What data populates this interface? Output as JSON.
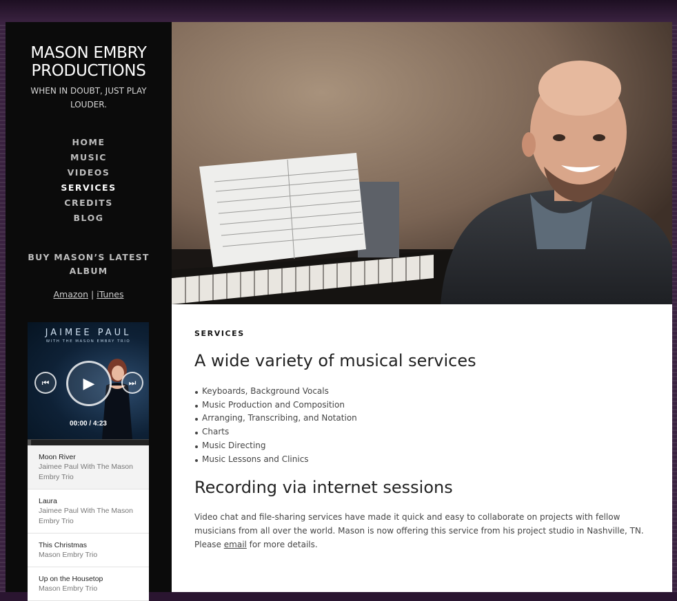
{
  "site": {
    "title_line1": "MASON EMBRY",
    "title_line2": "PRODUCTIONS",
    "tagline": "WHEN IN DOUBT, JUST PLAY LOUDER."
  },
  "nav": {
    "items": [
      "HOME",
      "MUSIC",
      "VIDEOS",
      "SERVICES",
      "CREDITS",
      "BLOG"
    ],
    "active": "SERVICES"
  },
  "buy": {
    "title": "BUY MASON’S LATEST ALBUM",
    "amazon": "Amazon",
    "separator": "|",
    "itunes": "iTunes"
  },
  "player": {
    "cover_artist": "JAIMEE PAUL",
    "cover_subtitle": "WITH THE MASON EMBRY TRIO",
    "time_current": "00:00",
    "time_separator": "/",
    "time_total": "4:23",
    "progress": 0.03,
    "icons": {
      "prev": "skip-back-icon",
      "play": "play-icon",
      "next": "skip-forward-icon"
    },
    "tracks": [
      {
        "title": "Moon River",
        "artist": "Jaimee Paul With The Mason Embry Trio"
      },
      {
        "title": "Laura",
        "artist": "Jaimee Paul With The Mason Embry Trio"
      },
      {
        "title": "This Christmas",
        "artist": "Mason Embry Trio"
      },
      {
        "title": "Up on the Housetop",
        "artist": "Mason Embry Trio"
      }
    ]
  },
  "content": {
    "label": "SERVICES",
    "heading1": "A wide variety of musical services",
    "services": [
      "Keyboards, Background Vocals",
      "Music Production and Composition",
      "Arranging, Transcribing, and Notation",
      "Charts",
      "Music Directing",
      "Music Lessons and Clinics"
    ],
    "heading2": "Recording via internet sessions",
    "paragraph_before": "Video chat and file-sharing services have made it quick and easy to collaborate on projects with fellow musicians from all over the world. Mason is now offering this service from his project studio in Nashville, TN. Please ",
    "paragraph_link": "email",
    "paragraph_after": " for more details."
  },
  "colors": {
    "sidebar_bg": "#0b0b0b",
    "page_bg": "#2a1530",
    "content_bg": "#ffffff"
  }
}
